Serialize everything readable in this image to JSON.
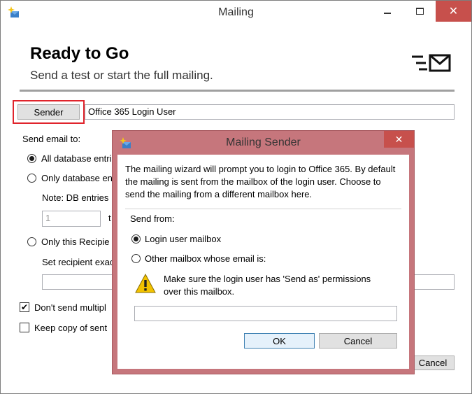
{
  "window": {
    "title": "Mailing",
    "icon": "sparkle-mail-icon",
    "controls": {
      "minimize": "minimize-icon",
      "maximize": "maximize-icon",
      "close": "✕"
    }
  },
  "header": {
    "title": "Ready to Go",
    "subtitle": "Send a test or start the full mailing.",
    "icon": "send-mail-icon"
  },
  "sender": {
    "button_label": "Sender",
    "value": "Office 365 Login User"
  },
  "send_email_to": {
    "label": "Send email to:",
    "option_all": "All database entri",
    "option_only_db": "Only database en",
    "note": "Note: DB entries",
    "count_value": "1",
    "count_suffix": "t",
    "option_only_recipient": "Only this Recipie",
    "recipient_label": "Set recipient exac",
    "recipient_value": ""
  },
  "options": {
    "dont_send_multiple": "Don't send multipl",
    "dont_send_multiple_checked": true,
    "keep_copy": "Keep copy of sent ",
    "keep_copy_checked": false
  },
  "background_cancel": "Cancel",
  "dialog": {
    "title": "Mailing Sender",
    "close": "✕",
    "message": "The mailing wizard will prompt you to login to Office 365. By default the mailing is sent from the mailbox of the login user. Choose to send the mailing from a different mailbox here.",
    "send_from_label": "Send from:",
    "option_login": "Login user mailbox",
    "option_other": "Other mailbox whose email is:",
    "selected": "login",
    "warning": "Make sure the login user has 'Send as' permissions over this mailbox.",
    "email_value": "",
    "ok_label": "OK",
    "cancel_label": "Cancel"
  },
  "colors": {
    "close_red": "#c7504c",
    "highlight_red": "#e0242c",
    "dialog_frame": "#c6767c",
    "ok_border": "#3c7fb1"
  }
}
